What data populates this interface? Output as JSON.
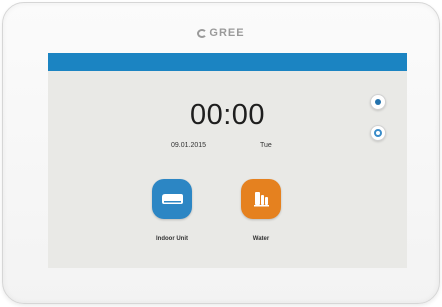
{
  "brand": {
    "name": "GREE"
  },
  "colors": {
    "accent_blue": "#1b84c2",
    "indoor_tile": "#2c86c4",
    "water_tile": "#e5811f",
    "screen_bg": "#e9e9e6"
  },
  "status": {
    "time": "00:00",
    "date": "09.01.2015",
    "day": "Tue"
  },
  "side_buttons": [
    {
      "icon": "dot-icon"
    },
    {
      "icon": "ring-icon"
    }
  ],
  "tiles": [
    {
      "label": "Indoor Unit",
      "icon": "indoor-unit-icon"
    },
    {
      "label": "Water",
      "icon": "water-heater-icon"
    }
  ]
}
